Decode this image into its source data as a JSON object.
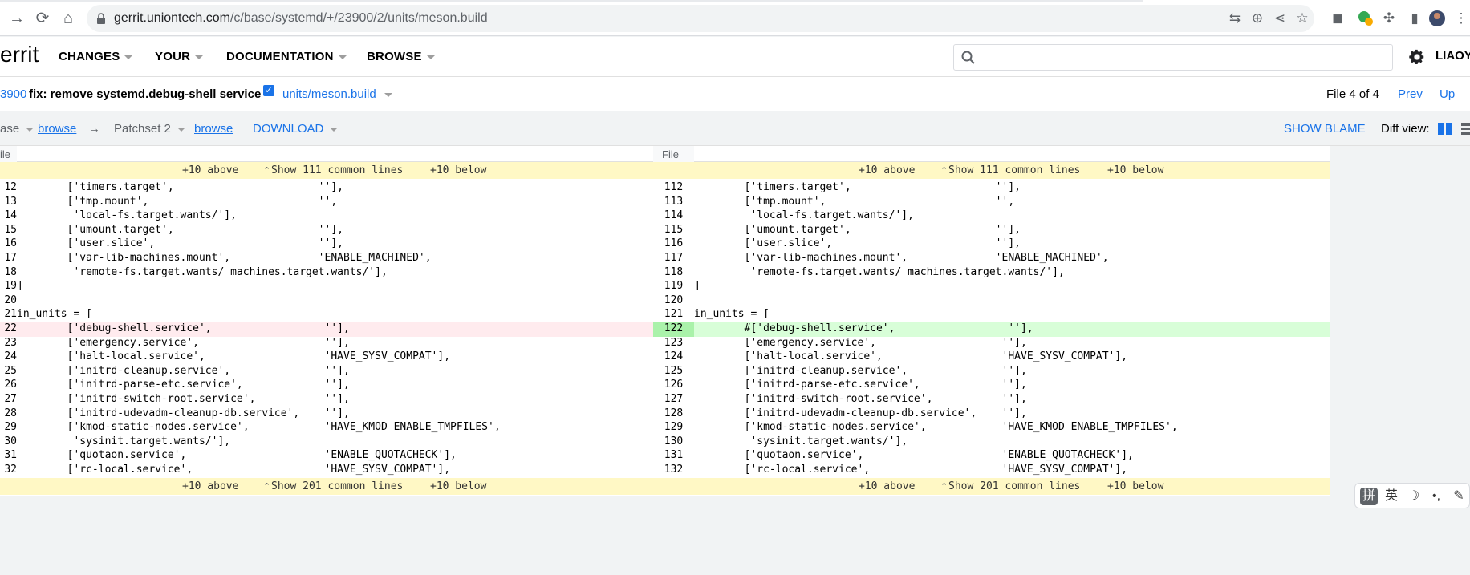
{
  "browser": {
    "url_host": "gerrit.uniontech.com",
    "url_path": "/c/base/systemd/+/23900/2/units/meson.build",
    "extension_badge": "3"
  },
  "header": {
    "logo": "errit",
    "menus": [
      "CHANGES",
      "YOUR",
      "DOCUMENTATION",
      "BROWSE"
    ],
    "search_placeholder": "",
    "user": "LIAOY"
  },
  "change": {
    "number": "3900",
    "title": "fix: remove systemd.debug-shell service",
    "file": "units/meson.build",
    "file_position": "File 4 of 4",
    "prev": "Prev",
    "up": "Up"
  },
  "patchset": {
    "base": "ase",
    "browse_left": "browse",
    "arrow": "→",
    "patchset": "Patchset 2",
    "browse_right": "browse",
    "download": "DOWNLOAD",
    "show_blame": "SHOW BLAME",
    "diff_view": "Diff view:"
  },
  "diff": {
    "left_header": "ile",
    "right_header": "File",
    "context_top": {
      "above": "+10 above",
      "show": "Show 111 common lines",
      "below": "+10 below"
    },
    "context_bottom": {
      "above": "+10 above",
      "show": "Show 201 common lines",
      "below": "+10 below"
    },
    "rows": [
      {
        "ln": "12",
        "lc": "        ['timers.target',                       ''],",
        "rn": "112",
        "rc": "        ['timers.target',                       ''],",
        "type": ""
      },
      {
        "ln": "13",
        "lc": "        ['tmp.mount',                           '',",
        "rn": "113",
        "rc": "        ['tmp.mount',                           '',",
        "type": ""
      },
      {
        "ln": "14",
        "lc": "         'local-fs.target.wants/'],",
        "rn": "114",
        "rc": "         'local-fs.target.wants/'],",
        "type": ""
      },
      {
        "ln": "15",
        "lc": "        ['umount.target',                       ''],",
        "rn": "115",
        "rc": "        ['umount.target',                       ''],",
        "type": ""
      },
      {
        "ln": "16",
        "lc": "        ['user.slice',                          ''],",
        "rn": "116",
        "rc": "        ['user.slice',                          ''],",
        "type": ""
      },
      {
        "ln": "17",
        "lc": "        ['var-lib-machines.mount',              'ENABLE_MACHINED',",
        "rn": "117",
        "rc": "        ['var-lib-machines.mount',              'ENABLE_MACHINED',",
        "type": ""
      },
      {
        "ln": "18",
        "lc": "         'remote-fs.target.wants/ machines.target.wants/'],",
        "rn": "118",
        "rc": "         'remote-fs.target.wants/ machines.target.wants/'],",
        "type": ""
      },
      {
        "ln": "19",
        "lc": "]",
        "rn": "119",
        "rc": "]",
        "type": ""
      },
      {
        "ln": "20",
        "lc": "",
        "rn": "120",
        "rc": "",
        "type": ""
      },
      {
        "ln": "21",
        "lc": "in_units = [",
        "rn": "121",
        "rc": "in_units = [",
        "type": ""
      },
      {
        "ln": "22",
        "lc": "        ['debug-shell.service',                  ''],",
        "rn": "122",
        "rc": "        #['debug-shell.service',                  ''],",
        "type": "chg"
      },
      {
        "ln": "23",
        "lc": "        ['emergency.service',                    ''],",
        "rn": "123",
        "rc": "        ['emergency.service',                    ''],",
        "type": ""
      },
      {
        "ln": "24",
        "lc": "        ['halt-local.service',                   'HAVE_SYSV_COMPAT'],",
        "rn": "124",
        "rc": "        ['halt-local.service',                   'HAVE_SYSV_COMPAT'],",
        "type": ""
      },
      {
        "ln": "25",
        "lc": "        ['initrd-cleanup.service',               ''],",
        "rn": "125",
        "rc": "        ['initrd-cleanup.service',               ''],",
        "type": ""
      },
      {
        "ln": "26",
        "lc": "        ['initrd-parse-etc.service',             ''],",
        "rn": "126",
        "rc": "        ['initrd-parse-etc.service',             ''],",
        "type": ""
      },
      {
        "ln": "27",
        "lc": "        ['initrd-switch-root.service',           ''],",
        "rn": "127",
        "rc": "        ['initrd-switch-root.service',           ''],",
        "type": ""
      },
      {
        "ln": "28",
        "lc": "        ['initrd-udevadm-cleanup-db.service',    ''],",
        "rn": "128",
        "rc": "        ['initrd-udevadm-cleanup-db.service',    ''],",
        "type": ""
      },
      {
        "ln": "29",
        "lc": "        ['kmod-static-nodes.service',            'HAVE_KMOD ENABLE_TMPFILES',",
        "rn": "129",
        "rc": "        ['kmod-static-nodes.service',            'HAVE_KMOD ENABLE_TMPFILES',",
        "type": ""
      },
      {
        "ln": "30",
        "lc": "         'sysinit.target.wants/'],",
        "rn": "130",
        "rc": "         'sysinit.target.wants/'],",
        "type": ""
      },
      {
        "ln": "31",
        "lc": "        ['quotaon.service',                      'ENABLE_QUOTACHECK'],",
        "rn": "131",
        "rc": "        ['quotaon.service',                      'ENABLE_QUOTACHECK'],",
        "type": ""
      },
      {
        "ln": "32",
        "lc": "        ['rc-local.service',                     'HAVE_SYSV_COMPAT'],",
        "rn": "132",
        "rc": "        ['rc-local.service',                     'HAVE_SYSV_COMPAT'],",
        "type": ""
      }
    ]
  },
  "ime": {
    "k1": "拼",
    "k2": "英",
    "k3": "☽",
    "k4": "•,",
    "k5": "✎"
  },
  "colors": {
    "accent": "#1a73e8",
    "removed": "#ffebee",
    "added": "#d8fed8",
    "context": "#fff8c5"
  }
}
